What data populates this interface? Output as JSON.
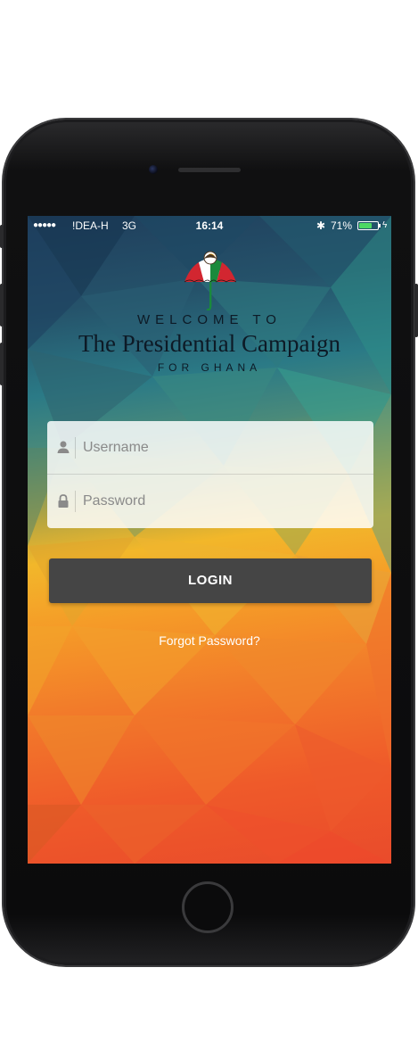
{
  "statusbar": {
    "signal": "●●●●●",
    "carrier": "!DEA-H",
    "network": "3G",
    "time": "16:14",
    "bluetooth": "✱",
    "battery_percent": "71%",
    "battery_level": 0.71,
    "charging": "ϟ"
  },
  "header": {
    "welcome": "WELCOME TO",
    "title": "The Presidential Campaign",
    "subtitle": "FOR GHANA"
  },
  "form": {
    "username_placeholder": "Username",
    "password_placeholder": "Password",
    "username_value": "",
    "password_value": ""
  },
  "actions": {
    "login_label": "LOGIN",
    "forgot_label": "Forgot Password?"
  },
  "colors": {
    "login_button": "#454545",
    "umbrella_red": "#d22630",
    "umbrella_green": "#1a8a3c",
    "battery_green": "#4cd964"
  },
  "icons": {
    "username": "user-icon",
    "password": "lock-icon",
    "logo": "umbrella-eagle-logo"
  }
}
